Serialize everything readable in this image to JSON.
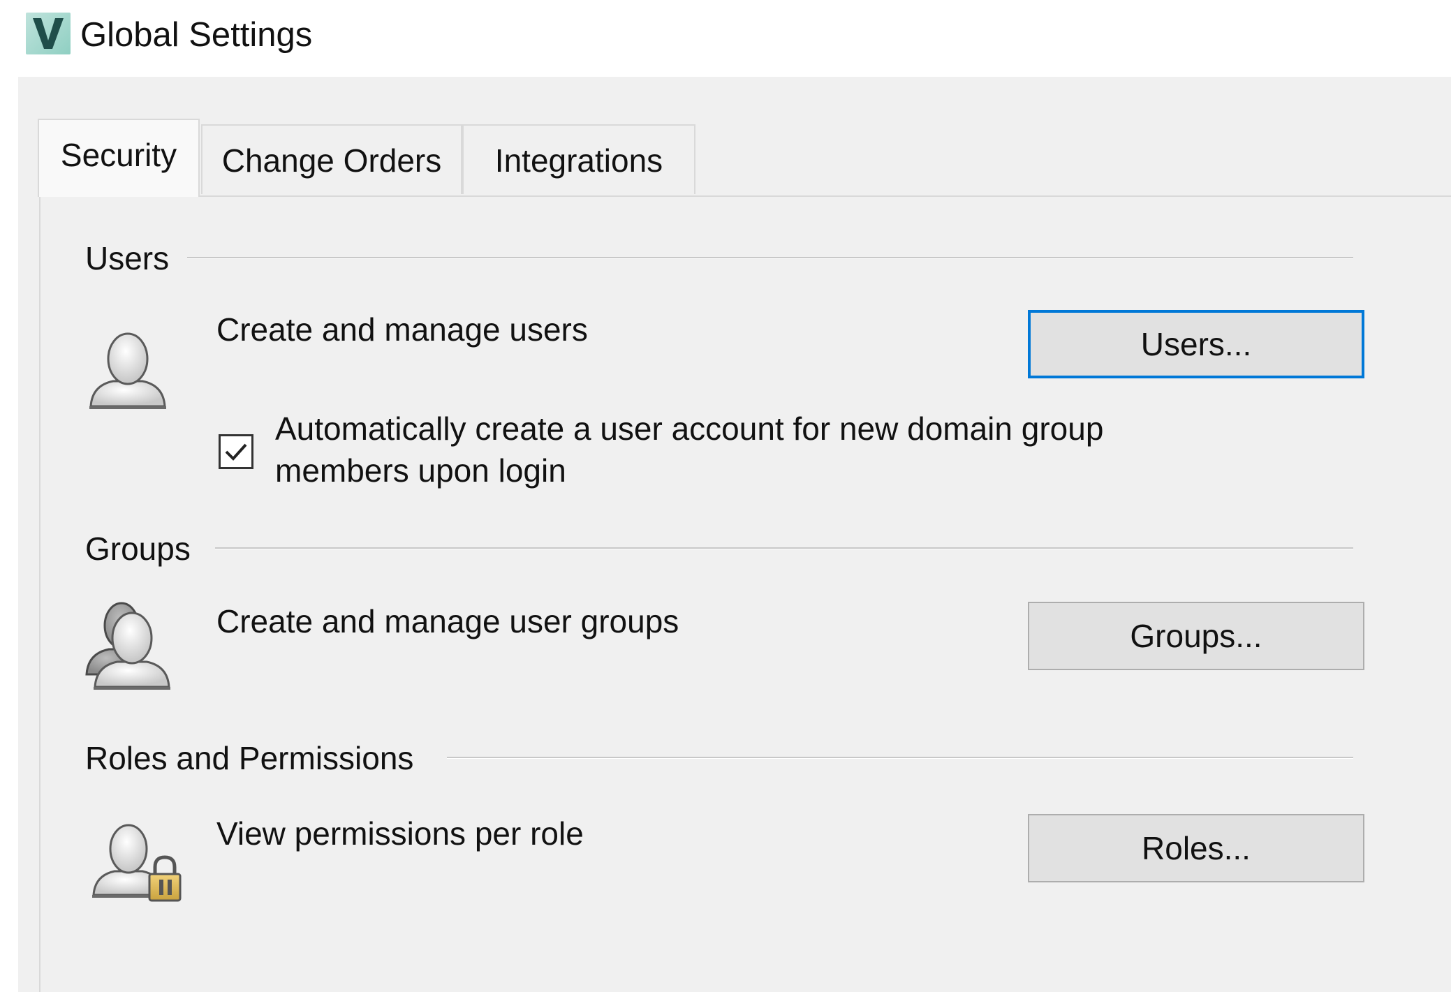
{
  "window": {
    "title": "Global Settings",
    "app_icon_letter": "V"
  },
  "tabs": [
    {
      "label": "Security",
      "active": true
    },
    {
      "label": "Change Orders",
      "active": false
    },
    {
      "label": "Integrations",
      "active": false
    }
  ],
  "sections": {
    "users": {
      "header": "Users",
      "description": "Create and manage users",
      "button_label": "Users...",
      "icon": "user-icon",
      "checkbox": {
        "checked": true,
        "label": "Automatically create a user account for new domain group members upon login"
      }
    },
    "groups": {
      "header": "Groups",
      "description": "Create and manage user groups",
      "button_label": "Groups...",
      "icon": "user-group-icon"
    },
    "roles": {
      "header": "Roles and Permissions",
      "description": "View permissions per role",
      "button_label": "Roles...",
      "icon": "user-lock-icon"
    }
  },
  "colors": {
    "focus_accent": "#0078d7",
    "dialog_bg": "#f0f0f0",
    "button_bg": "#e1e1e1",
    "app_icon_letter": "#1f4e4a"
  }
}
